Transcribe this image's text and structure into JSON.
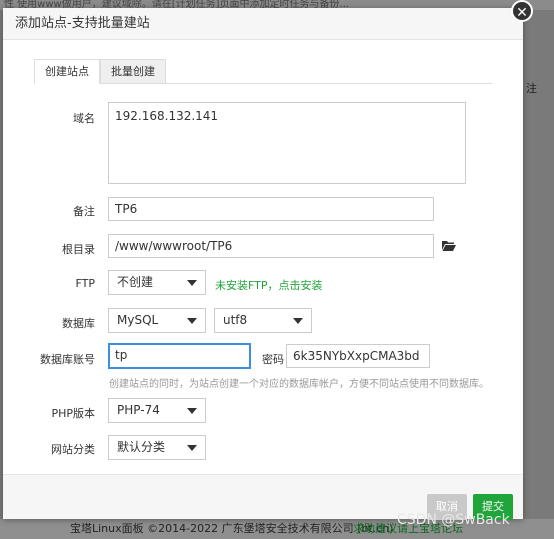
{
  "background": {
    "top_text": "性  使用www做用户，建议域除。请在[计划任务]页面中添加定时任务与备份...",
    "right_label": "注",
    "footer_copyright": "宝塔Linux面板 ©2014-2022 广东堡塔安全技术有限公司 (bt.cn)",
    "footer_help": "求助建议请上宝塔论坛",
    "watermark": "CSDN @SwBack"
  },
  "modal": {
    "title": "添加站点-支持批量建站",
    "close_glyph": "✕",
    "tabs": [
      "创建站点",
      "批量创建"
    ],
    "fields": {
      "domain_label": "域名",
      "domain_value": "192.168.132.141",
      "remark_label": "备注",
      "remark_value": "TP6",
      "root_label": "根目录",
      "root_value": "/www/wwwroot/TP6",
      "ftp_label": "FTP",
      "ftp_selected": "不创建",
      "ftp_link": "未安装FTP，点击安装",
      "db_label": "数据库",
      "db_type_selected": "MySQL",
      "db_charset_selected": "utf8",
      "db_account_label": "数据库账号",
      "db_account_value": "tp",
      "db_password_label": "密码",
      "db_password_value": "6k35NYbXxpCMA3bd",
      "db_hint": "创建站点的同时，为站点创建一个对应的数据库帐户，方便不同站点使用不同数据库。",
      "php_label": "PHP版本",
      "php_selected": "PHP-74",
      "category_label": "网站分类",
      "category_selected": "默认分类"
    },
    "buttons": {
      "cancel": "取消",
      "submit": "提交"
    }
  },
  "colors": {
    "accent_green": "#20a53a",
    "focus_blue": "#3d8ee0"
  }
}
